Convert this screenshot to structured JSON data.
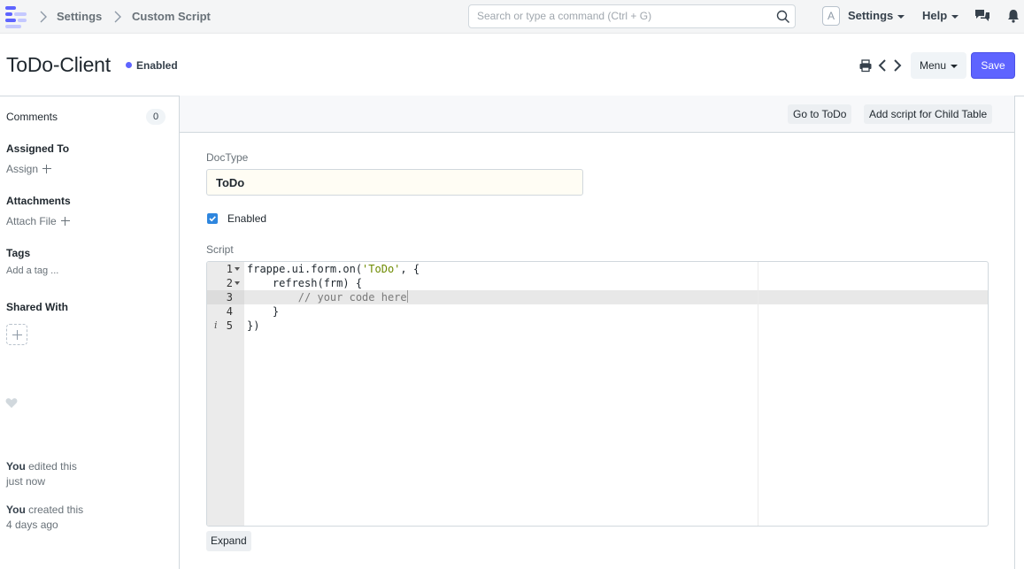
{
  "navbar": {
    "breadcrumbs": [
      "Settings",
      "Custom Script"
    ],
    "search_placeholder": "Search or type a command (Ctrl + G)",
    "avatar_letter": "A",
    "settings_label": "Settings",
    "help_label": "Help"
  },
  "page": {
    "title": "ToDo-Client",
    "status": "Enabled",
    "status_color": "#5e64ff",
    "menu_label": "Menu",
    "save_label": "Save"
  },
  "sidebar": {
    "comments_label": "Comments",
    "comments_count": "0",
    "assigned_to_label": "Assigned To",
    "assign_label": "Assign",
    "attachments_label": "Attachments",
    "attach_file_label": "Attach File",
    "tags_label": "Tags",
    "add_tag_label": "Add a tag ...",
    "shared_with_label": "Shared With",
    "timeline": [
      {
        "who": "You",
        "action": " edited this",
        "when": "just now"
      },
      {
        "who": "You",
        "action": " created this",
        "when": "4 days ago"
      }
    ]
  },
  "form": {
    "toolbar_buttons": [
      "Go to ToDo",
      "Add script for Child Table"
    ],
    "doctype_label": "DocType",
    "doctype_value": "ToDo",
    "enabled_label": "Enabled",
    "enabled_checked": true,
    "script_label": "Script",
    "expand_label": "Expand",
    "code_lines": [
      {
        "number": "1",
        "prefix": "frappe.ui.form.on(",
        "string": "'ToDo'",
        "suffix": ", {"
      },
      {
        "number": "2",
        "text": "    refresh(frm) {"
      },
      {
        "number": "3",
        "comment": "        // your code here"
      },
      {
        "number": "4",
        "text": "    }"
      },
      {
        "number": "5",
        "text": "})"
      }
    ],
    "active_line": "3"
  }
}
